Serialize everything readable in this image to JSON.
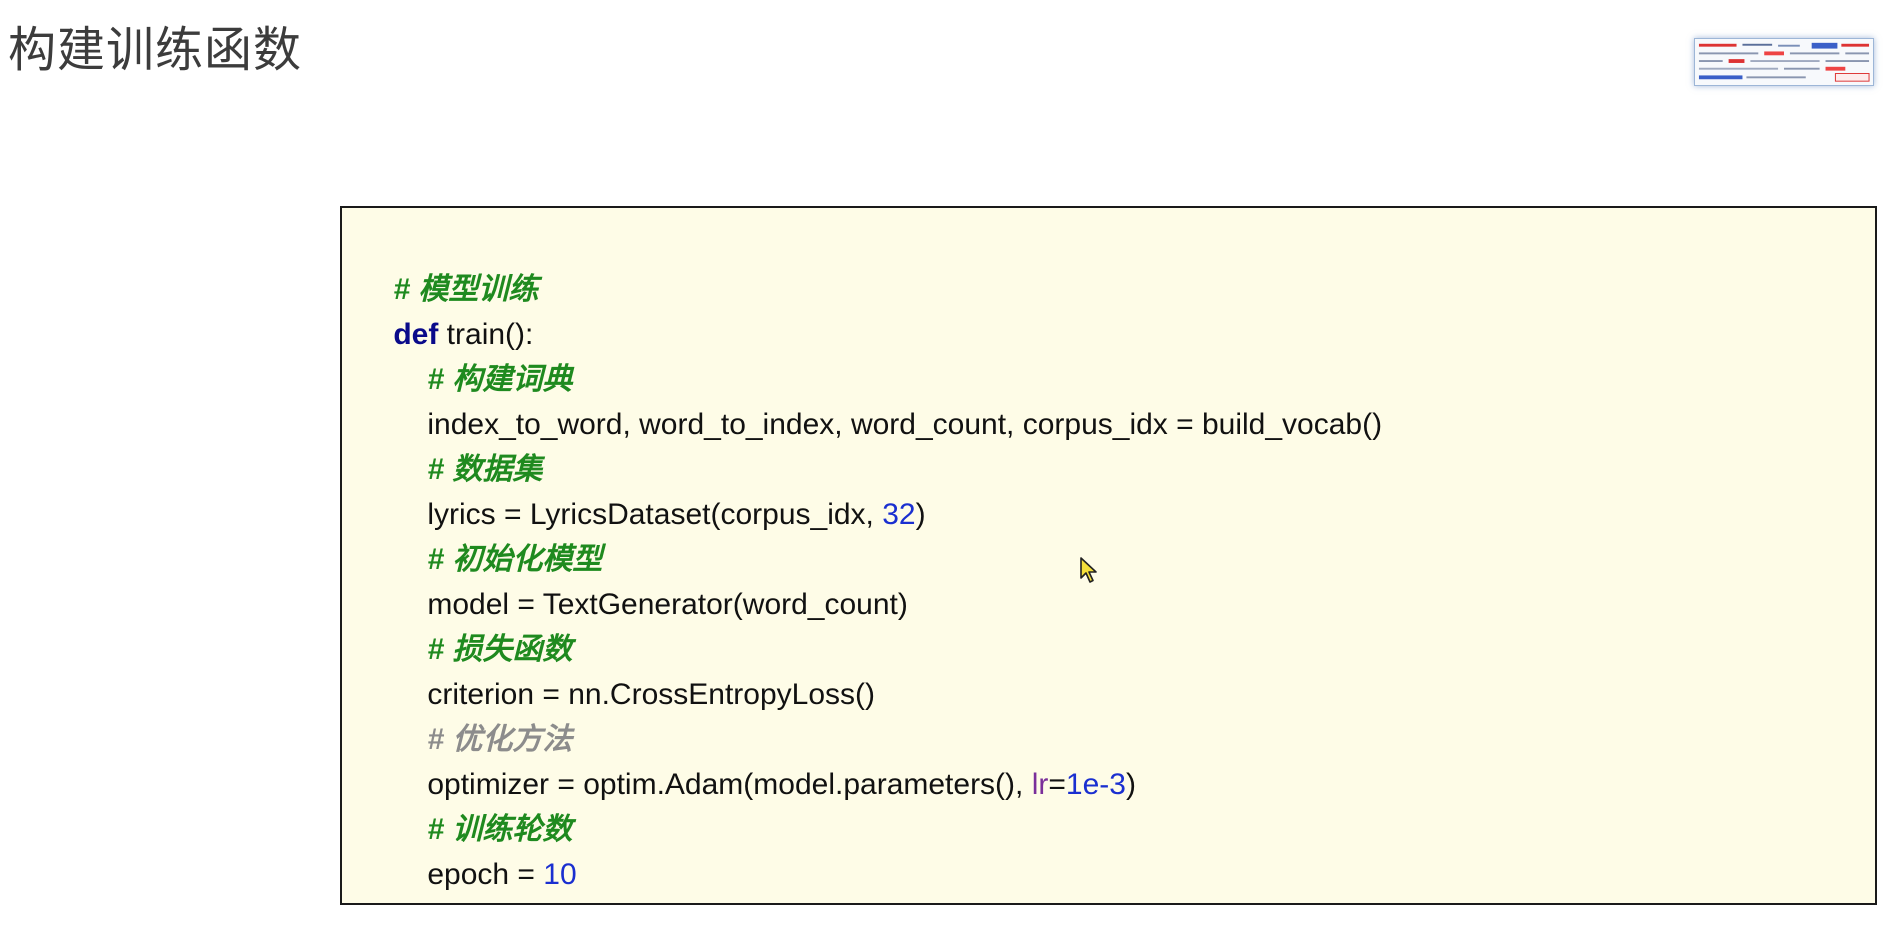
{
  "slide": {
    "title": "构建训练函数"
  },
  "code": {
    "line_1_comment": "# 模型训练",
    "line_2_keyword": "def",
    "line_2_rest": " train():",
    "line_3_comment": "# 构建词典",
    "line_4": "index_to_word, word_to_index, word_count, corpus_idx = build_vocab()",
    "line_5_comment": "# 数据集",
    "line_6_pre": "lyrics = LyricsDataset(corpus_idx, ",
    "line_6_num": "32",
    "line_6_post": ")",
    "line_7_comment": "# 初始化模型",
    "line_8": "model = TextGenerator(word_count)",
    "line_9_comment": "# 损失函数",
    "line_10": "criterion = nn.CrossEntropyLoss()",
    "line_11_comment": "# 优化方法",
    "line_12_pre": "optimizer = optim.Adam(model.parameters(), ",
    "line_12_kwarg": "lr",
    "line_12_eq": "=",
    "line_12_num": "1e-3",
    "line_12_post": ")",
    "line_13_comment": "# 训练轮数",
    "line_14_pre": "epoch = ",
    "line_14_num": "10"
  },
  "icons": {
    "cursor": "mouse-pointer-icon",
    "thumbnail": "slide-thumbnail"
  },
  "colors": {
    "comment": "#1f8a1f",
    "comment_gray": "#8c8c8c",
    "keyword": "#0a0a8a",
    "number": "#1a2fd0",
    "kwarg": "#7a2f9a",
    "code_background": "#fefce7",
    "cursor": "#f5e03a"
  }
}
